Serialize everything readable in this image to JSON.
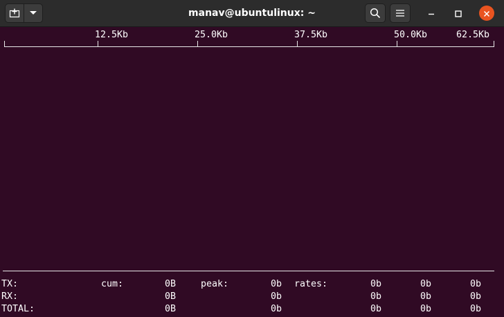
{
  "window": {
    "title": "manav@ubuntulinux: ~"
  },
  "icons": {
    "new_tab": "new-tab-icon",
    "tab_menu": "chevron-down-icon",
    "search": "search-icon",
    "menu": "hamburger-icon",
    "minimize": "minimize-icon",
    "maximize": "maximize-icon",
    "close": "close-icon"
  },
  "colors": {
    "terminal_bg": "#300a24",
    "titlebar_bg": "#2c2c2c",
    "close_button": "#e95420",
    "text": "#ffffff"
  },
  "scale": {
    "ticks": [
      "12.5Kb",
      "25.0Kb",
      "37.5Kb",
      "50.0Kb",
      "62.5Kb"
    ]
  },
  "stats": {
    "tx": {
      "label": "TX:",
      "cum_label": "cum:",
      "cum": "0B",
      "peak_label": "peak:",
      "peak": "0b",
      "rates_label": "rates:",
      "rates": [
        "0b",
        "0b",
        "0b"
      ]
    },
    "rx": {
      "label": "RX:",
      "cum": "0B",
      "peak": "0b",
      "rates": [
        "0b",
        "0b",
        "0b"
      ]
    },
    "total": {
      "label": "TOTAL:",
      "cum": "0B",
      "peak": "0b",
      "rates": [
        "0b",
        "0b",
        "0b"
      ]
    }
  }
}
